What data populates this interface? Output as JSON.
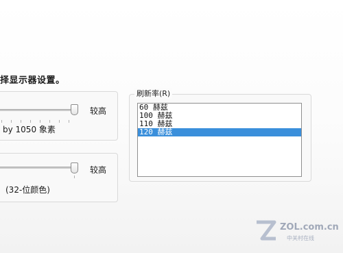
{
  "instruction": "择显示器设置。",
  "resolution": {
    "high_label": "较高",
    "value_text": "by 1050 象素"
  },
  "color_quality": {
    "high_label": "较高",
    "value_text": "(32-位颜色)"
  },
  "refresh": {
    "legend": "刷新率(R)",
    "options": [
      "60 赫兹",
      "100 赫兹",
      "110 赫兹",
      "120 赫兹"
    ],
    "selected": "120 赫兹"
  },
  "watermark": {
    "text": "ZOL.com.cn",
    "subtext": "中关村在线"
  }
}
